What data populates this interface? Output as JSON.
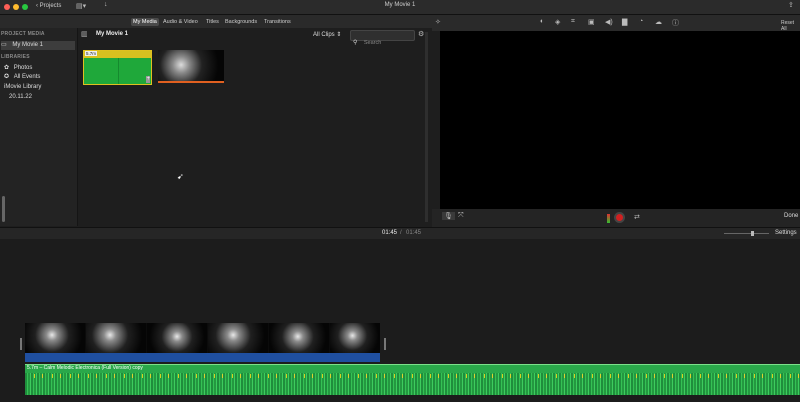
{
  "window": {
    "title": "My Movie 1",
    "back_label": "Projects"
  },
  "colors": {
    "close": "#ff5f57",
    "minimize": "#febc2e",
    "zoom": "#28c840",
    "clip_green": "#1fa83a",
    "video_bar_blue": "#1f4fa0",
    "audio_green": "#2aa84a"
  },
  "media_tabs": [
    "My Media",
    "Audio & Video",
    "Titles",
    "Backgrounds",
    "Transitions"
  ],
  "sidebar": {
    "project_header": "PROJECT MEDIA",
    "project_item": "My Movie 1",
    "libraries_header": "LIBRARIES",
    "items": [
      "Photos",
      "All Events",
      "iMovie Library",
      "20.11.22"
    ]
  },
  "browser": {
    "title": "My Movie 1",
    "filter": "All Clips",
    "search_placeholder": "Search",
    "clip1_duration": "5.7m"
  },
  "viewer": {
    "reset_label": "Reset All",
    "done_label": "Done"
  },
  "timeline": {
    "current_time": "01:45",
    "separator": "/",
    "total_time": "01:45",
    "settings_label": "Settings",
    "audio_clip_label": "5.7m – Calm Melodic Electronica (Full Version) copy"
  }
}
